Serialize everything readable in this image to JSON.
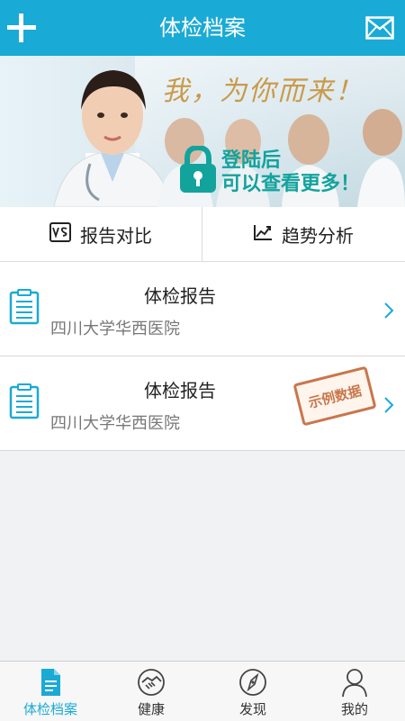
{
  "header": {
    "title": "体检档案",
    "left_icon": "plus-icon",
    "right_icon": "mail-icon"
  },
  "banner": {
    "slogan": "我，为你而来！",
    "cta_line1": "登陆后",
    "cta_line2": "可以查看更多！"
  },
  "toolbar": {
    "compare_label": "报告对比",
    "trend_label": "趋势分析"
  },
  "reports": [
    {
      "title": "体检报告",
      "hospital": "四川大学华西医院",
      "stamp": ""
    },
    {
      "title": "体检报告",
      "hospital": "四川大学华西医院",
      "stamp": "示例数据"
    }
  ],
  "tabs": [
    {
      "label": "体检档案",
      "icon": "document-icon",
      "active": true
    },
    {
      "label": "健康",
      "icon": "handshake-icon",
      "active": false
    },
    {
      "label": "发现",
      "icon": "compass-icon",
      "active": false
    },
    {
      "label": "我的",
      "icon": "user-icon",
      "active": false
    }
  ],
  "colors": {
    "accent": "#1aaad6",
    "banner_text": "#12a39d",
    "stamp": "#c9764b"
  }
}
